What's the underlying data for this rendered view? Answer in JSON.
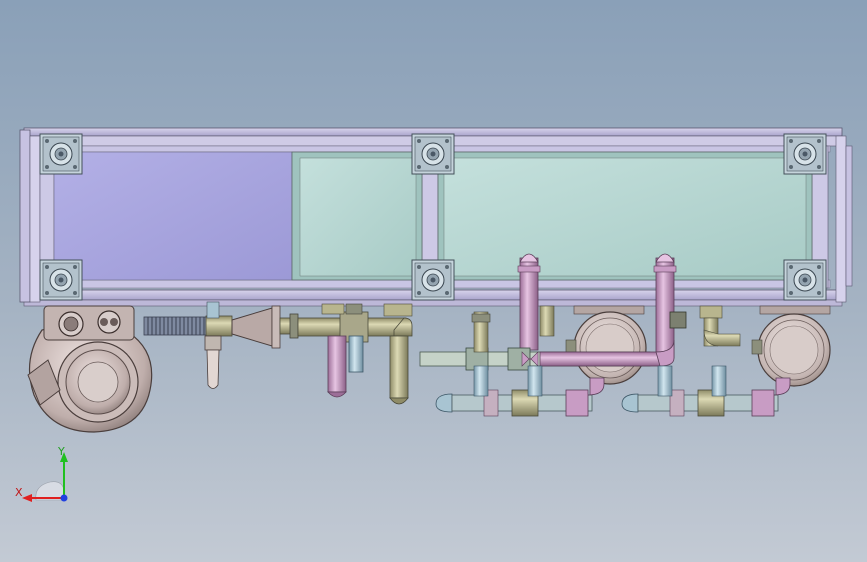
{
  "viewport": {
    "background_top": "#8aa0b8",
    "background_bottom": "#c3cad4"
  },
  "colors": {
    "frame": "#b9b3d6",
    "frame_edge": "#5a5870",
    "panel_left": "#a7a4dc",
    "panel_right": "#b4d3cf",
    "pipe_tan": "#b8b58e",
    "pipe_pink": "#c89cc4",
    "pipe_blue": "#a8c4d2",
    "pump_body": "#c7b7b4",
    "fitting": "#8c8f7c"
  },
  "triad": {
    "x_label": "X",
    "y_label": "Y",
    "x_color": "#e02020",
    "y_color": "#20c020",
    "z_color": "#2040e0"
  }
}
